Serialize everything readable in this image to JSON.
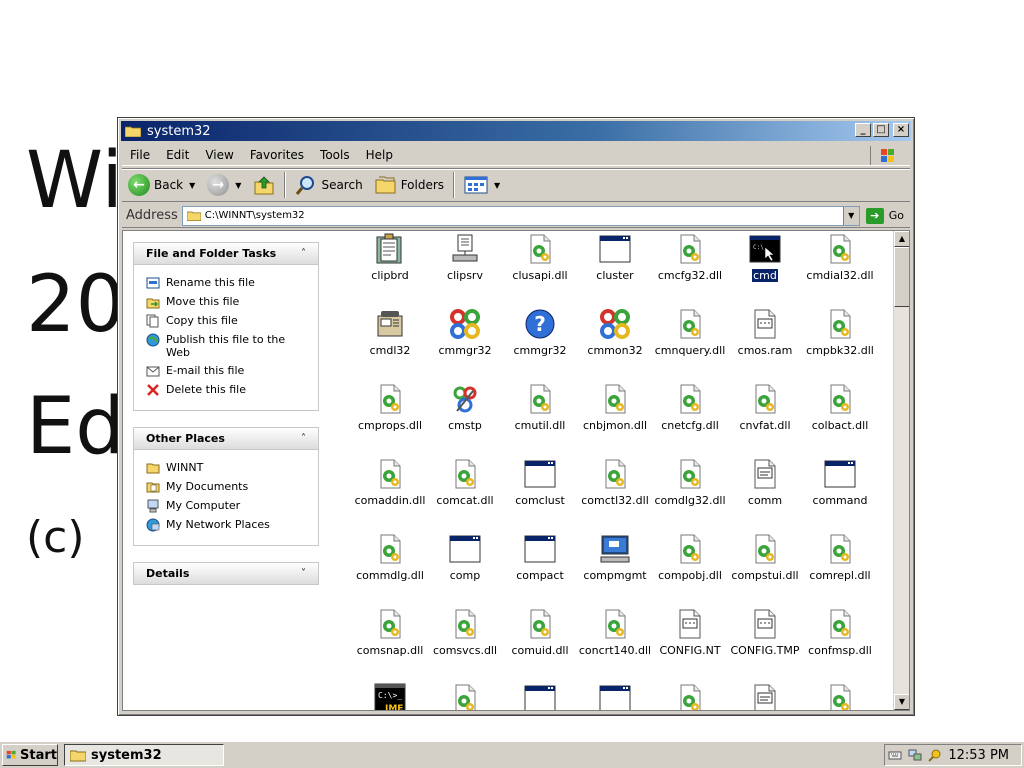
{
  "background": {
    "line1": "Wi",
    "line2": "20",
    "line3": "Ed",
    "line4": "(c)"
  },
  "window": {
    "title": "system32",
    "buttons": [
      "_",
      "□",
      "×"
    ]
  },
  "menu": [
    "File",
    "Edit",
    "View",
    "Favorites",
    "Tools",
    "Help"
  ],
  "toolbar": {
    "back": "Back",
    "search": "Search",
    "folders": "Folders"
  },
  "address": {
    "label": "Address",
    "path": "C:\\WINNT\\system32",
    "go": "Go"
  },
  "tasks": {
    "title": "File and Folder Tasks",
    "items": [
      "Rename this file",
      "Move this file",
      "Copy this file",
      "Publish this file to the Web",
      "E-mail this file",
      "Delete this file"
    ]
  },
  "places": {
    "title": "Other Places",
    "items": [
      "WINNT",
      "My Documents",
      "My Computer",
      "My Network Places"
    ]
  },
  "details": {
    "title": "Details"
  },
  "files": [
    {
      "name": "clipbrd",
      "icon": "clipboard-icon"
    },
    {
      "name": "clipsrv",
      "icon": "clipboard-server-icon"
    },
    {
      "name": "clusapi.dll",
      "icon": "dll-icon"
    },
    {
      "name": "cluster",
      "icon": "window-app-icon"
    },
    {
      "name": "cmcfg32.dll",
      "icon": "dll-icon"
    },
    {
      "name": "cmd",
      "icon": "console-icon"
    },
    {
      "name": "cmdial32.dll",
      "icon": "dll-icon"
    },
    {
      "name": "cmdl32",
      "icon": "phone-icon"
    },
    {
      "name": "cmmgr32",
      "icon": "cm-icon"
    },
    {
      "name": "cmmgr32",
      "icon": "help-icon"
    },
    {
      "name": "cmmon32",
      "icon": "cm-icon"
    },
    {
      "name": "cmnquery.dll",
      "icon": "dll-icon"
    },
    {
      "name": "cmos.ram",
      "icon": "data-file-icon"
    },
    {
      "name": "cmpbk32.dll",
      "icon": "dll-icon"
    },
    {
      "name": "cmprops.dll",
      "icon": "dll-icon"
    },
    {
      "name": "cmstp",
      "icon": "cm-setup-icon"
    },
    {
      "name": "cmutil.dll",
      "icon": "dll-icon"
    },
    {
      "name": "cnbjmon.dll",
      "icon": "dll-icon"
    },
    {
      "name": "cnetcfg.dll",
      "icon": "dll-icon"
    },
    {
      "name": "cnvfat.dll",
      "icon": "dll-icon"
    },
    {
      "name": "colbact.dll",
      "icon": "dll-icon"
    },
    {
      "name": "comaddin.dll",
      "icon": "dll-icon"
    },
    {
      "name": "comcat.dll",
      "icon": "dll-icon"
    },
    {
      "name": "comclust",
      "icon": "window-app-icon"
    },
    {
      "name": "comctl32.dll",
      "icon": "dll-icon"
    },
    {
      "name": "comdlg32.dll",
      "icon": "dll-icon"
    },
    {
      "name": "comm",
      "icon": "text-file-icon"
    },
    {
      "name": "command",
      "icon": "window-app-icon"
    },
    {
      "name": "commdlg.dll",
      "icon": "dll-icon"
    },
    {
      "name": "comp",
      "icon": "window-app-icon"
    },
    {
      "name": "compact",
      "icon": "window-app-icon"
    },
    {
      "name": "compmgmt",
      "icon": "computer-management-icon"
    },
    {
      "name": "compobj.dll",
      "icon": "dll-icon"
    },
    {
      "name": "compstui.dll",
      "icon": "dll-icon"
    },
    {
      "name": "comrepl.dll",
      "icon": "dll-icon"
    },
    {
      "name": "comsnap.dll",
      "icon": "dll-icon"
    },
    {
      "name": "comsvcs.dll",
      "icon": "dll-icon"
    },
    {
      "name": "comuid.dll",
      "icon": "dll-icon"
    },
    {
      "name": "concrt140.dll",
      "icon": "dll-icon"
    },
    {
      "name": "CONFIG.NT",
      "icon": "data-file-icon"
    },
    {
      "name": "CONFIG.TMP",
      "icon": "data-file-icon"
    },
    {
      "name": "confmsp.dll",
      "icon": "dll-icon"
    },
    {
      "name": "",
      "icon": "ime-console-icon"
    },
    {
      "name": "",
      "icon": "dll-icon"
    },
    {
      "name": "",
      "icon": "window-app-icon"
    },
    {
      "name": "",
      "icon": "window-app-icon"
    },
    {
      "name": "",
      "icon": "dll-icon"
    },
    {
      "name": "",
      "icon": "text-file-icon"
    },
    {
      "name": "",
      "icon": "dll-icon"
    }
  ],
  "selected_file": "cmd",
  "taskbar": {
    "start": "Start",
    "task": "system32",
    "clock": "12:53 PM"
  }
}
